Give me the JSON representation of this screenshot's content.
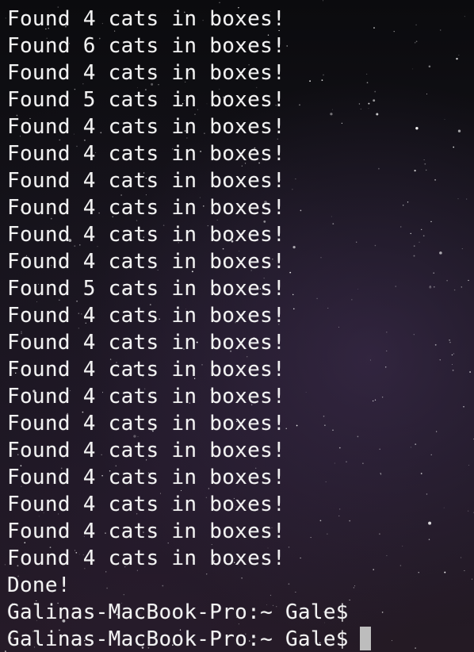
{
  "terminal": {
    "output_lines": [
      "Found 4 cats in boxes!",
      "Found 6 cats in boxes!",
      "Found 4 cats in boxes!",
      "Found 5 cats in boxes!",
      "Found 4 cats in boxes!",
      "Found 4 cats in boxes!",
      "Found 4 cats in boxes!",
      "Found 4 cats in boxes!",
      "Found 4 cats in boxes!",
      "Found 4 cats in boxes!",
      "Found 5 cats in boxes!",
      "Found 4 cats in boxes!",
      "Found 4 cats in boxes!",
      "Found 4 cats in boxes!",
      "Found 4 cats in boxes!",
      "Found 4 cats in boxes!",
      "Found 4 cats in boxes!",
      "Found 4 cats in boxes!",
      "Found 4 cats in boxes!",
      "Found 4 cats in boxes!",
      "Found 4 cats in boxes!",
      "Done!"
    ],
    "prompt_lines": [
      "Galinas-MacBook-Pro:~ Gale$",
      "Galinas-MacBook-Pro:~ Gale$"
    ],
    "colors": {
      "text": "#f2f2f2",
      "cursor": "#bdbdbd",
      "background": "#15131a"
    },
    "background_image": "starfield"
  }
}
